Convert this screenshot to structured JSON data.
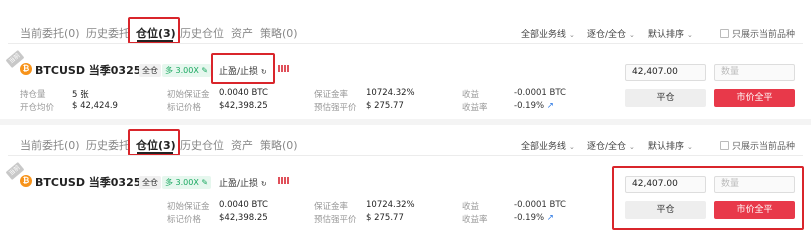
{
  "tabs": [
    {
      "label": "当前委托(0)"
    },
    {
      "label": "历史委托"
    },
    {
      "label": "仓位(3)"
    },
    {
      "label": "历史仓位"
    },
    {
      "label": "资产"
    },
    {
      "label": "策略(0)"
    }
  ],
  "filters": {
    "business": "全部业务线",
    "mode": "逐仓/全仓",
    "sort": "默认排序",
    "only_current": "只展示当前品种"
  },
  "position": {
    "ribbon": "当前",
    "coin_symbol": "₿",
    "symbol": "BTCUSD 当季0325",
    "margin_mode": "全仓",
    "leverage": "多 3.00X",
    "tp_sl": "止盈/止损",
    "labels": {
      "holding": "持仓量",
      "open_avg": "开仓均价",
      "init_margin": "初始保证金",
      "mark_price": "标记价格",
      "margin_rate": "保证金率",
      "est_liq": "预估强平价",
      "pnl": "收益",
      "pnl_rate": "收益率"
    },
    "values": {
      "holding": "5 张",
      "open_avg": "$ 42,424.9",
      "init_margin": "0.0040 BTC",
      "mark_price": "$42,398.25",
      "margin_rate": "10724.32%",
      "est_liq": "$ 275.77",
      "pnl": "-0.0001 BTC",
      "pnl_rate": "-0.19%"
    },
    "price_input": "42,407.00",
    "qty_placeholder": "数量",
    "close_btn": "平仓",
    "market_close_btn": "市价全平"
  },
  "colors": {
    "accent_red": "#d9252b",
    "market_btn": "#e8394a",
    "long_green": "#1aa860"
  }
}
